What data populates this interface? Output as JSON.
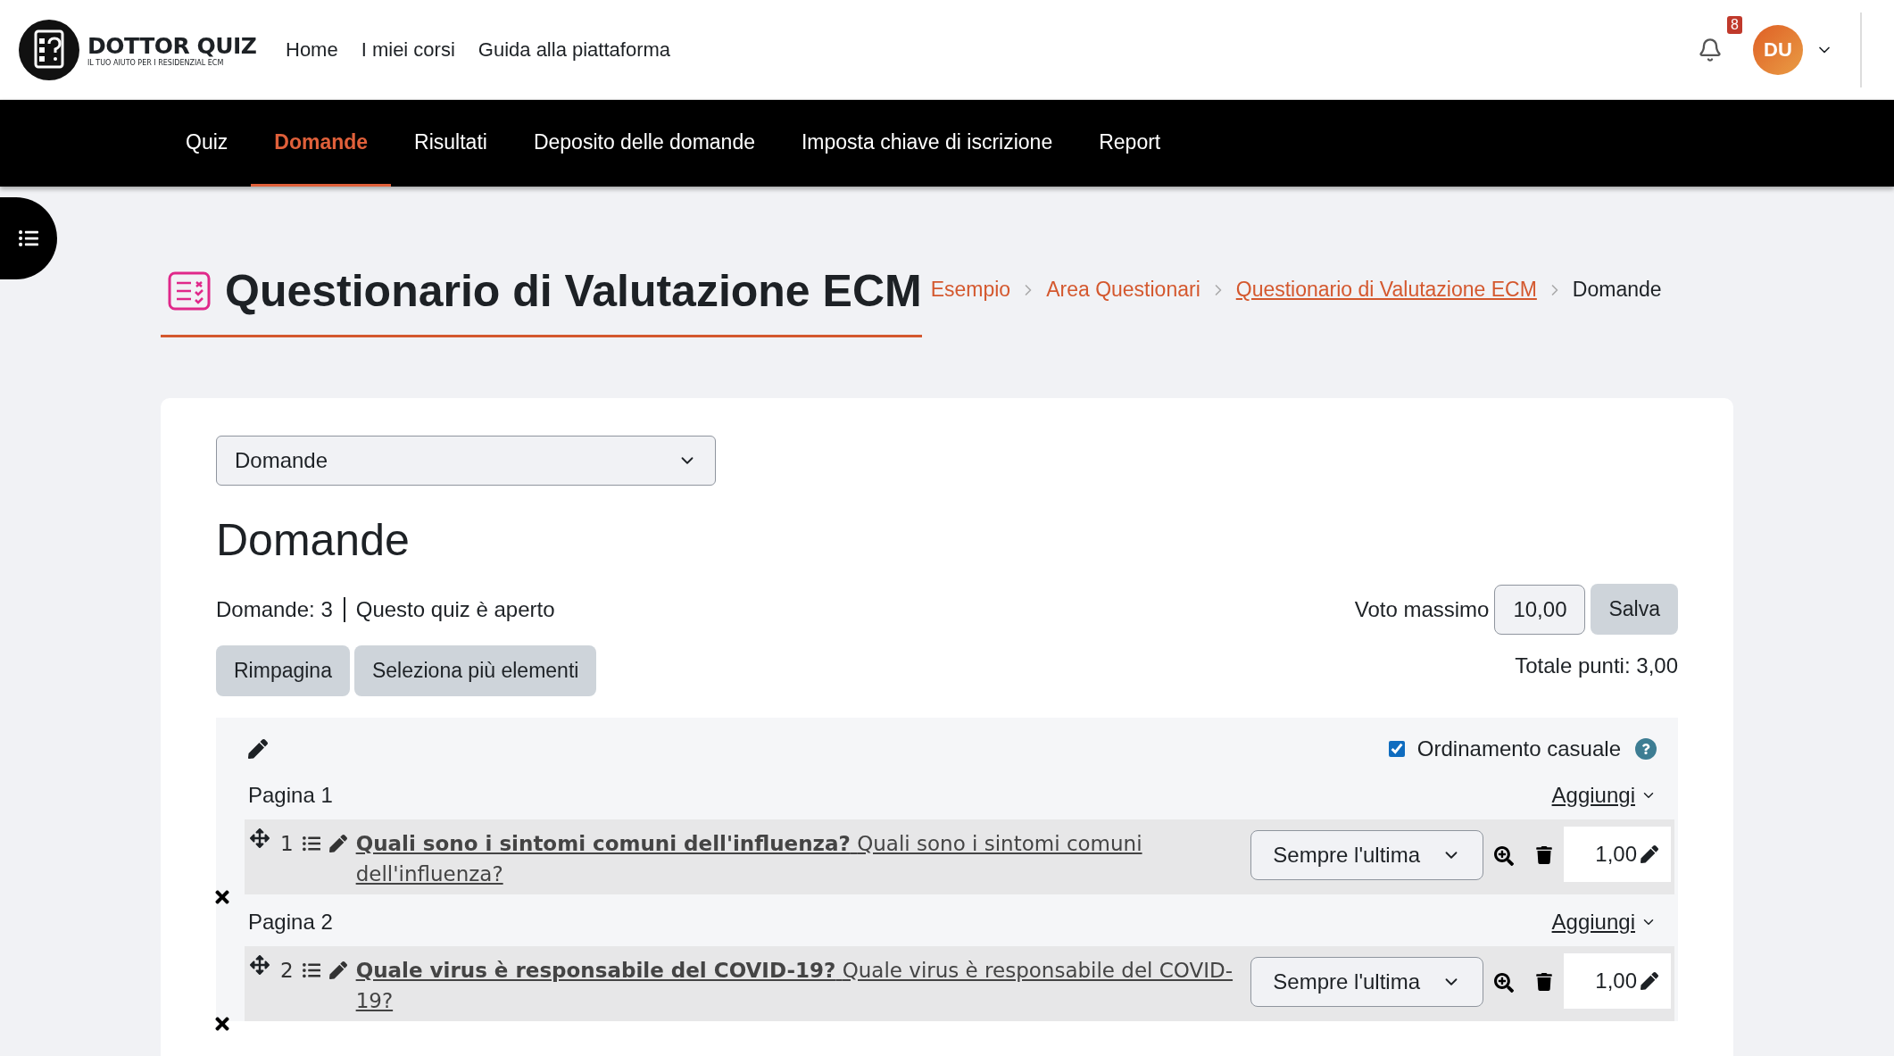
{
  "logo": {
    "title": "DOTTOR QUIZ",
    "tagline": "IL TUO AIUTO PER I RESIDENZIAL ECM"
  },
  "top_nav": [
    "Home",
    "I miei corsi",
    "Guida alla piattaforma"
  ],
  "notifications": {
    "count": "8"
  },
  "user": {
    "initials": "DU"
  },
  "course_nav": [
    {
      "label": "Quiz",
      "selected": false
    },
    {
      "label": "Domande",
      "selected": true
    },
    {
      "label": "Risultati",
      "selected": false
    },
    {
      "label": "Deposito delle domande",
      "selected": false
    },
    {
      "label": "Imposta chiave di iscrizione",
      "selected": false
    },
    {
      "label": "Report",
      "selected": false
    }
  ],
  "page": {
    "title": "Questionario di Valutazione ECM",
    "breadcrumb": [
      {
        "label": "Esempio",
        "kind": "link"
      },
      {
        "label": "Area Questionari",
        "kind": "link"
      },
      {
        "label": "Questionario di Valutazione ECM",
        "kind": "hovered"
      },
      {
        "label": "Domande",
        "kind": "current"
      }
    ]
  },
  "section_select": {
    "value": "Domande"
  },
  "heading": "Domande",
  "summary": {
    "count": "Domande: 3",
    "status": "Questo quiz è aperto"
  },
  "max_grade": {
    "label": "Voto massimo",
    "value": "10,00",
    "button": "Salva"
  },
  "buttons": [
    "Rimpagina",
    "Seleziona più elementi"
  ],
  "total": "Totale punti: 3,00",
  "shuffle": {
    "label": "Ordinamento casuale",
    "checked": true
  },
  "pages": [
    {
      "title": "Pagina 1",
      "add": "Aggiungi",
      "questions": [
        {
          "number": "1",
          "name": "Quali sono i sintomi comuni dell'influenza?",
          "text": "Quali sono i sintomi comuni dell'influenza?",
          "dependency": "Sempre l'ultima",
          "mark": "1,00"
        }
      ]
    },
    {
      "title": "Pagina 2",
      "add": "Aggiungi",
      "questions": [
        {
          "number": "2",
          "name": "Quale virus è responsabile del COVID-19?",
          "text": "Quale virus è responsabile del COVID-19?",
          "dependency": "Sempre l'ultima",
          "mark": "1,00"
        }
      ]
    }
  ]
}
